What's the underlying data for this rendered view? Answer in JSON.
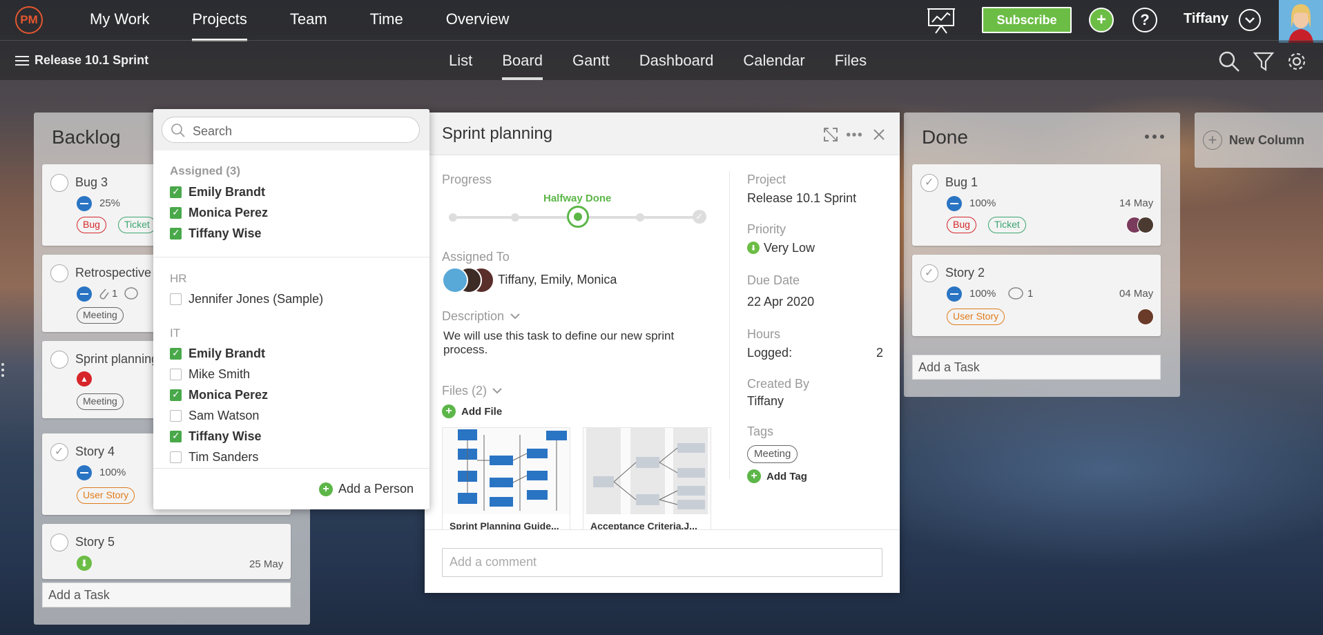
{
  "app": {
    "logo": "PM",
    "main_nav": [
      "My Work",
      "Projects",
      "Team",
      "Time",
      "Overview"
    ],
    "subscribe_label": "Subscribe",
    "user_name": "Tiffany"
  },
  "project": {
    "name": "Release 10.1 Sprint",
    "views": [
      "List",
      "Board",
      "Gantt",
      "Dashboard",
      "Calendar",
      "Files"
    ],
    "active_view": "Board"
  },
  "columns": {
    "backlog": {
      "title": "Backlog",
      "cards": [
        {
          "title": "Bug 3",
          "progress": "25%",
          "tags": [
            "Bug",
            "Ticket"
          ]
        },
        {
          "title": "Retrospective",
          "attachments": "1",
          "tags": [
            "Meeting"
          ]
        },
        {
          "title": "Sprint planning",
          "tags": [
            "Meeting"
          ]
        },
        {
          "title": "Story 4",
          "progress": "100%",
          "tags": [
            "User Story"
          ]
        },
        {
          "title": "Story 5",
          "due": "25 May"
        }
      ],
      "add_task": "Add a Task"
    },
    "done": {
      "title": "Done",
      "cards": [
        {
          "title": "Bug 1",
          "progress": "100%",
          "due": "14 May",
          "tags": [
            "Bug",
            "Ticket"
          ]
        },
        {
          "title": "Story 2",
          "progress": "100%",
          "comments": "1",
          "due": "04 May",
          "tags": [
            "User Story"
          ]
        }
      ],
      "add_task": "Add a Task"
    },
    "new_column_label": "New Column"
  },
  "people_picker": {
    "search_placeholder": "Search",
    "sections": [
      {
        "title": "Assigned (3)",
        "people": [
          {
            "name": "Emily Brandt",
            "checked": true
          },
          {
            "name": "Monica Perez",
            "checked": true
          },
          {
            "name": "Tiffany Wise",
            "checked": true
          }
        ]
      },
      {
        "title": "HR",
        "people": [
          {
            "name": "Jennifer Jones (Sample)",
            "checked": false
          }
        ]
      },
      {
        "title": "IT",
        "people": [
          {
            "name": "Emily Brandt",
            "checked": true
          },
          {
            "name": "Mike Smith",
            "checked": false
          },
          {
            "name": "Monica Perez",
            "checked": true
          },
          {
            "name": "Sam Watson",
            "checked": false
          },
          {
            "name": "Tiffany Wise",
            "checked": true
          },
          {
            "name": "Tim Sanders",
            "checked": false
          }
        ]
      }
    ],
    "add_person": "Add a Person"
  },
  "task_detail": {
    "title": "Sprint planning",
    "progress_label": "Progress",
    "progress_state": "Halfway Done",
    "progress_fraction": 0.5,
    "assigned_to_label": "Assigned To",
    "assigned_to_value": "Tiffany, Emily, Monica",
    "description_label": "Description",
    "description": "We will use this task to define our new sprint process.",
    "files_label": "Files (2)",
    "add_file": "Add File",
    "files": [
      "Sprint Planning Guide...",
      "Acceptance Criteria.J..."
    ],
    "project_label": "Project",
    "project_value": "Release 10.1 Sprint",
    "priority_label": "Priority",
    "priority_value": "Very Low",
    "due_label": "Due Date",
    "due_value": "22 Apr 2020",
    "hours_label": "Hours",
    "logged_label": "Logged:",
    "logged_value": "2",
    "created_by_label": "Created By",
    "created_by_value": "Tiffany",
    "tags_label": "Tags",
    "tags": [
      "Meeting"
    ],
    "add_tag": "Add Tag",
    "comment_placeholder": "Add a comment"
  },
  "colors": {
    "accent_green": "#5cb648",
    "priority_blue": "#2a74c4",
    "bug_red": "#d6262a",
    "ticket_green": "#3ca56f",
    "story_orange": "#e07b1a",
    "logo_red": "#e4572e"
  }
}
